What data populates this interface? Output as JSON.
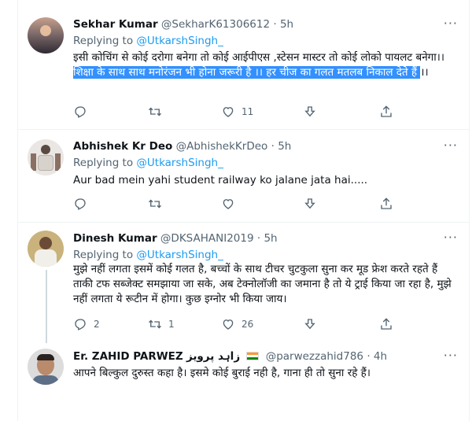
{
  "tweets": [
    {
      "name": "Sekhar Kumar",
      "handle": "@SekharK61306612",
      "sep": "·",
      "time": "5h",
      "replying_prefix": "Replying to ",
      "replying_to": "@UtkarshSingh_",
      "text_plain": "इसी कोचिंग से कोई दरोगा बनेगा तो कोई आईपीएस ,स्टेसन मास्टर तो कोई लोको पायलट बनेगा।। ",
      "text_selected": "शिक्षा के साथ साथ मनोरंजन भी होना जरूरी है ।। हर चीज का गलत मतलब निकाल देते हैं ",
      "text_tail": "।।",
      "reply_count": "",
      "retweet_count": "",
      "like_count": "11"
    },
    {
      "name": "Abhishek Kr Deo",
      "handle": "@AbhishekKrDeo",
      "sep": "·",
      "time": "5h",
      "replying_prefix": "Replying to ",
      "replying_to": "@UtkarshSingh_",
      "text": "Aur bad mein yahi student railway ko jalane jata hai.....",
      "reply_count": "",
      "retweet_count": "",
      "like_count": ""
    },
    {
      "name": "Dinesh Kumar",
      "handle": "@DKSAHANI2019",
      "sep": "·",
      "time": "5h",
      "replying_prefix": "Replying to ",
      "replying_to": "@UtkarshSingh_",
      "text": "मुझे नहीं लगता इसमें कोई गलत है, बच्चों के साथ टीचर चुटकुला सुना कर मूड फ्रेश करते रहते हैं ताकी टफ सब्जेक्ट समझाया जा सके, अब टेक्नोलॉजी का जमाना है तो ये ट्राई किया जा रहा है, मुझे नहीं लगता ये रूटीन में होगा। कुछ इग्नोर भी किया जाय।",
      "reply_count": "2",
      "retweet_count": "1",
      "like_count": "26"
    },
    {
      "name": "Er. ZAHID PARWEZ",
      "name_urdu": "زاہد پرویز",
      "flag": "india-flag",
      "handle": "@parwezzahid786",
      "sep": "·",
      "time": "4h",
      "text": "आपने बिल्कुल दुरुस्त कहा है। इसमे कोई बुराई नही है, गाना ही तो सुना रहे हैं।"
    }
  ],
  "more_label": "···",
  "colors": {
    "accent": "#1d9bf0",
    "selection": "#3390ff",
    "muted": "#536471",
    "divider": "#eff3f4"
  }
}
